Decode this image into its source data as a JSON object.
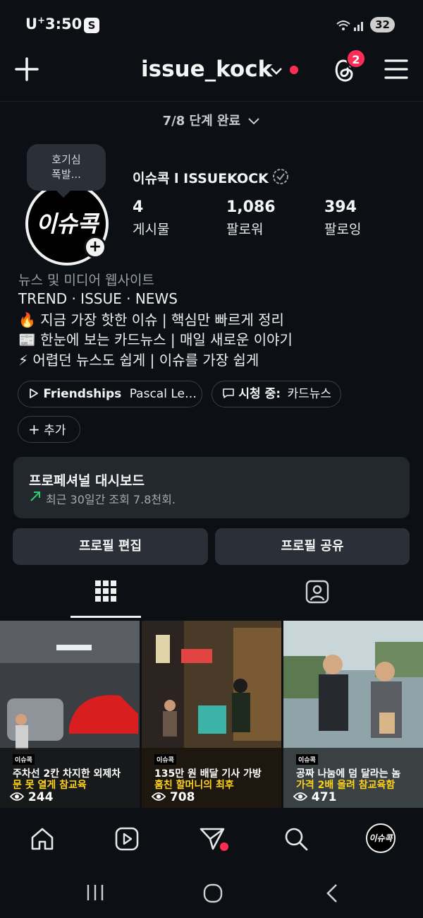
{
  "status": {
    "carrier": "U",
    "carrier_sup": "+",
    "time": "3:50",
    "app_badge": "S",
    "battery": "32"
  },
  "header": {
    "username": "issue_kock",
    "notification_count": "2"
  },
  "progress": {
    "text": "7/8 단계 완료"
  },
  "profile": {
    "tooltip_line1": "호기심",
    "tooltip_line2": "폭발...",
    "avatar_text": "이슈콕",
    "display_name": "이슈콕 l ISSUEKOCK",
    "stats": [
      {
        "value": "4",
        "label": "게시물"
      },
      {
        "value": "1,086",
        "label": "팔로워"
      },
      {
        "value": "394",
        "label": "팔로잉"
      }
    ],
    "category": "뉴스 및 미디어 웹사이트",
    "bio": [
      "TREND · ISSUE · NEWS",
      "🔥 지금 가장 핫한 이슈 | 핵심만 빠르게 정리",
      "📰 한눈에 보는 카드뉴스 | 매일 새로운 이야기",
      "⚡ 어렵던 뉴스도 쉽게 | 이슈를 가장 쉽게"
    ]
  },
  "chips": {
    "music_title": "Friendships",
    "music_artist": "Pascal Le…",
    "watching_label": "시청 중:",
    "watching_value": "카드뉴스",
    "add_label": "추가"
  },
  "dashboard": {
    "title": "프로페셔널 대시보드",
    "subtitle": "최근 30일간 조회 7.8천회."
  },
  "buttons": {
    "edit": "프로필 편집",
    "share": "프로필 공유"
  },
  "posts": [
    {
      "tag": "이슈콕",
      "line1": "주차선 2칸 차지한 외제차",
      "line2": "문 못 열게 참교육",
      "views": "244"
    },
    {
      "tag": "이슈콕",
      "line1": "135만 원 배달 기사 가방",
      "line2": "훔친 할머니의 최후",
      "views": "708"
    },
    {
      "tag": "이슈콕",
      "line1": "공짜 나눔에 덤 달라는 놈",
      "line2": "가격 2배 올려 참교육함",
      "views": "471"
    }
  ],
  "nav": {
    "avatar_text": "이슈콕"
  },
  "colors": {
    "accent_red": "#ff2d55",
    "background": "#0c0f14",
    "card": "#23272e",
    "highlight_yellow": "#ffd21a",
    "trend_green": "#2ecc71"
  }
}
